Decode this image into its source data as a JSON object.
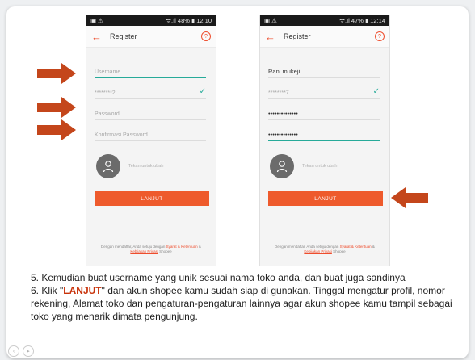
{
  "left_phone": {
    "status_left": "▣ ⚠",
    "status_right": "ᯤ.ıl 48% ▮ 12:10",
    "title": "Register",
    "username_placeholder": "Username",
    "masked_phone": "********2",
    "password_placeholder": "Password",
    "confirm_placeholder": "Konfirmasi Password",
    "photo_label": "Tekan untuk ubah",
    "button_label": "LANJUT",
    "terms_prefix": "Dengan mendaftar, Anda setuju dengan",
    "terms_link1": "Syarat & Ketentuan",
    "terms_and": "&",
    "terms_link2": "Kebijakan Privasi",
    "terms_suffix": "Shopee"
  },
  "right_phone": {
    "status_left": "▣ ⚠",
    "status_right": "ᯤ.ıl 47% ▮ 12:14",
    "title": "Register",
    "username_value": "Rani.mukeji",
    "masked_phone": "********7",
    "password_value": "••••••••••••••",
    "confirm_value": "••••••••••••••",
    "photo_label": "Tekan untuk ubah",
    "button_label": "LANJUT",
    "terms_prefix": "Dengan mendaftar, Anda setuju dengan",
    "terms_link1": "Syarat & Ketentuan",
    "terms_and": "&",
    "terms_link2": "Kebijakan Privasi",
    "terms_suffix": "Shopee"
  },
  "instructions": {
    "step5": "5. Kemudian buat username yang unik sesuai nama toko anda, dan buat juga sandinya",
    "step6_prefix": "6. Klik \"",
    "step6_highlight": "LANJUT",
    "step6_suffix": "\" dan akun shopee kamu sudah siap di gunakan. Tinggal mengatur profil, nomor rekening, Alamat toko dan pengaturan-pengaturan lainnya agar akun shopee kamu tampil sebagai toko yang menarik dimata pengunjung."
  },
  "colors": {
    "accent": "#ee4d2d",
    "button": "#ee5a2c",
    "arrow": "#c4461b",
    "check": "#26aa99"
  }
}
